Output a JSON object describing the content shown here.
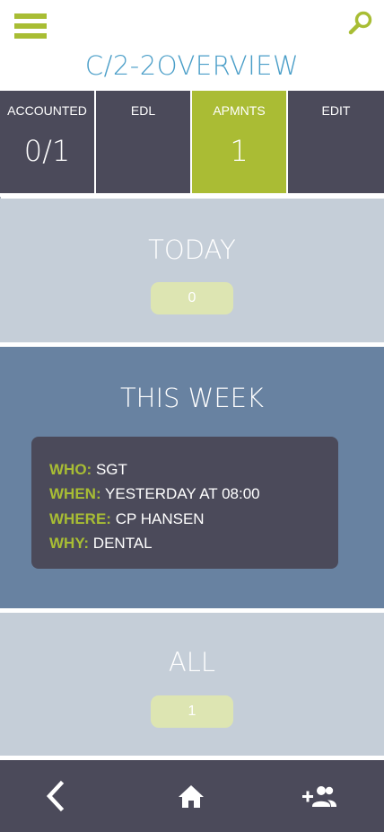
{
  "header": {
    "title": "C/2-2OVERVIEW",
    "menu_icon": "hamburger-menu-icon",
    "search_icon": "search-icon",
    "accent_color": "#a8bd34",
    "title_color": "#4a9ec8"
  },
  "tabs": [
    {
      "label": "ACCOUNTED",
      "value": "0/1",
      "active": false
    },
    {
      "label": "EDL",
      "value": "",
      "active": false
    },
    {
      "label": "APMNTS",
      "value": "1",
      "active": true
    },
    {
      "label": "EDIT",
      "value": "",
      "active": false
    }
  ],
  "sections": {
    "today": {
      "title": "TODAY",
      "count": "0"
    },
    "this_week": {
      "title": "THIS WEEK",
      "appointment": {
        "who_label": "WHO:",
        "who": "SGT",
        "when_label": "WHEN:",
        "when": "YESTERDAY AT 08:00",
        "where_label": "WHERE:",
        "where": "CP HANSEN",
        "why_label": "WHY:",
        "why": "DENTAL"
      }
    },
    "all": {
      "title": "ALL",
      "count": "1"
    }
  },
  "bottom_nav": [
    {
      "icon": "back-chevron-icon"
    },
    {
      "icon": "home-icon"
    },
    {
      "icon": "add-person-icon"
    }
  ],
  "colors": {
    "dark": "#4b4a5a",
    "active_tab": "#aabc34",
    "light_section": "#c5ced8",
    "week_section": "#6882a1",
    "pill": "#dde5b2"
  }
}
